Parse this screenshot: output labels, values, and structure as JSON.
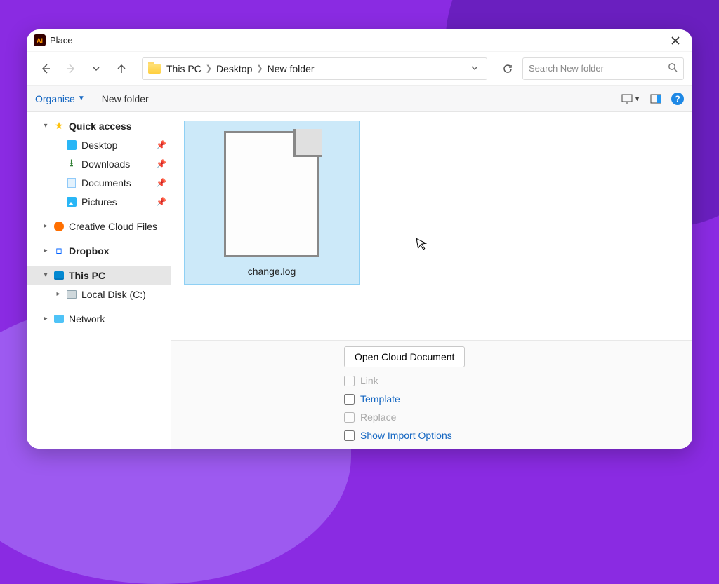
{
  "titlebar": {
    "app_icon_text": "Ai",
    "title": "Place"
  },
  "nav": {
    "breadcrumb": [
      "This PC",
      "Desktop",
      "New folder"
    ],
    "search_placeholder": "Search New folder"
  },
  "toolbar": {
    "organise": "Organise",
    "new_folder": "New folder"
  },
  "sidebar": {
    "quick_access": "Quick access",
    "items_quick": [
      {
        "label": "Desktop"
      },
      {
        "label": "Downloads"
      },
      {
        "label": "Documents"
      },
      {
        "label": "Pictures"
      }
    ],
    "creative_cloud": "Creative Cloud Files",
    "dropbox": "Dropbox",
    "this_pc": "This PC",
    "local_disk": "Local Disk (C:)",
    "network": "Network"
  },
  "files": [
    {
      "name": "change.log"
    }
  ],
  "footer": {
    "cloud_button": "Open Cloud Document",
    "link": "Link",
    "template": "Template",
    "replace": "Replace",
    "show_import": "Show Import Options"
  }
}
